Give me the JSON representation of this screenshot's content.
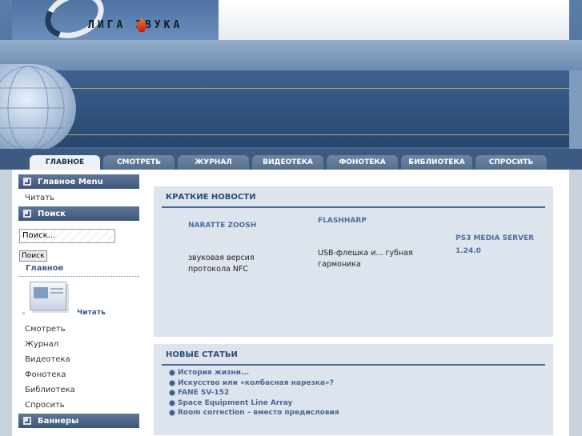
{
  "header": {
    "logo_text": "ЛИГА ЗВУКА"
  },
  "nav": {
    "tabs": [
      "ГЛАВНОЕ",
      "СМОТРЕТЬ",
      "ЖУРНАЛ",
      "ВИДЕОТЕКА",
      "ФОНОТЕКА",
      "БИБЛИОТЕКА",
      "СПРОСИТЬ"
    ],
    "active": "ГЛАВНОЕ"
  },
  "sidebar": {
    "main_menu_title": "Главное Menu",
    "main_menu_items": [
      "Читать"
    ],
    "search_title": "Поиск",
    "search_value": "Поиск...",
    "search_button": "Поиск",
    "section_label": "Главное",
    "featured_label": "Читать",
    "links": [
      "Смотреть",
      "Журнал",
      "Видеотека",
      "Фонотека",
      "Библиотека",
      "Спросить"
    ],
    "banners_title": "Баннеры"
  },
  "news": {
    "title": "КРАТКИЕ НОВОСТИ",
    "items": [
      {
        "title": "NARATTE ZOOSH",
        "text": "звуковая версия протокола NFC"
      },
      {
        "title": "FLASHHARP",
        "text": "USB-флешка и... губная гармоника"
      },
      {
        "title": "PS3 MEDIA SERVER",
        "text": "1.24.0"
      }
    ]
  },
  "articles": {
    "title": "НОВЫЕ СТАТЬИ",
    "items": [
      "История жизни...",
      "Искусство или «колбасная нарезка»?",
      "FANE SV-152",
      "Space Equipment Line Array",
      "Room correction – вместо предисловия"
    ]
  }
}
